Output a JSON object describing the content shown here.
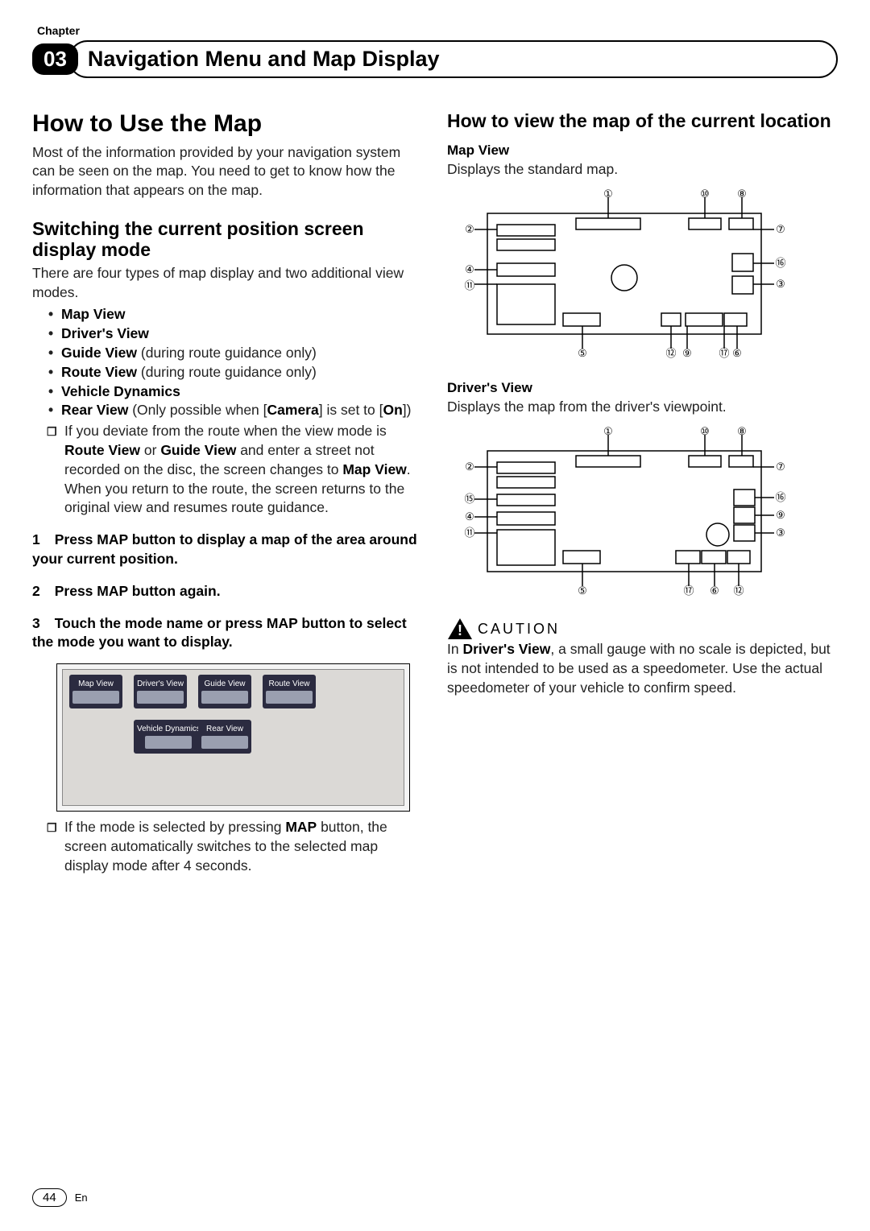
{
  "chapter": {
    "label": "Chapter",
    "number": "03",
    "title": "Navigation Menu and Map Display"
  },
  "left": {
    "section_title": "How to Use the Map",
    "intro": "Most of the information provided by your navigation system can be seen on the map. You need to get to know how the information that appears on the map.",
    "switch_title": "Switching the current position screen display mode",
    "switch_text": "There are four types of map display and two additional view modes.",
    "bullets": {
      "map_view": "Map View",
      "drivers_view": "Driver's View",
      "guide_view_b": "Guide View",
      "guide_view_t": " (during route guidance only)",
      "route_view_b": "Route View",
      "route_view_t": " (during route guidance only)",
      "vehicle_dyn": "Vehicle Dynamics",
      "rear_view_b": "Rear View",
      "rear_view_t1": " (Only possible when [",
      "rear_view_cam": "Camera",
      "rear_view_t2": "] is set to [",
      "rear_view_on": "On",
      "rear_view_t3": "])"
    },
    "note1_a": "If you deviate from the route when the view mode is ",
    "note1_rv": "Route View",
    "note1_or": " or ",
    "note1_gv": "Guide View",
    "note1_b": " and enter a street not recorded on the disc, the screen changes to ",
    "note1_mv": "Map View",
    "note1_c": ". When you return to the route, the screen returns to the original view and resumes route guidance.",
    "step1": "Press MAP button to display a map of the area around your current position.",
    "step2": "Press MAP button again.",
    "step3": "Touch the mode name or press MAP button to select the mode you want to display.",
    "modes": {
      "m1": "Map View",
      "m2": "Driver's View",
      "m3": "Guide View",
      "m4": "Route View",
      "m5": "Vehicle Dynamics",
      "m6": "Rear View"
    },
    "note2_a": "If the mode is selected by pressing ",
    "note2_map": "MAP",
    "note2_b": " button, the screen automatically switches to the selected map display mode after 4 seconds."
  },
  "right": {
    "section_title": "How to view the map of the current location",
    "map_view_h": "Map View",
    "map_view_t": "Displays the standard map.",
    "drivers_h": "Driver's View",
    "drivers_t": "Displays the map from the driver's viewpoint.",
    "caution_label": "CAUTION",
    "caution_a": "In ",
    "caution_dv": "Driver's View",
    "caution_b": ", a small gauge with no scale is depicted, but is not intended to be used as a speedometer. Use the actual speedometer of your vehicle to confirm speed."
  },
  "footer": {
    "page": "44",
    "lang": "En"
  }
}
